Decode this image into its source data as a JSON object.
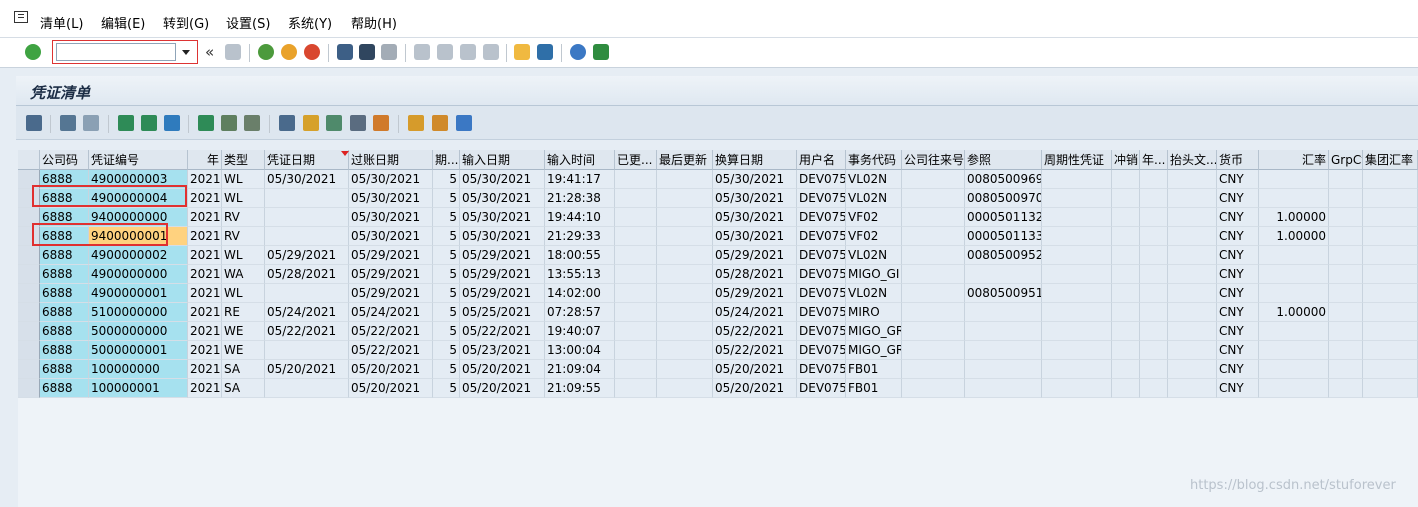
{
  "menu": [
    "清单(L)",
    "编辑(E)",
    "转到(G)",
    "设置(S)",
    "系统(Y)",
    "帮助(H)"
  ],
  "command_field": {
    "value": ""
  },
  "back_chevrons": "«",
  "title": "凭证清单",
  "columns": [
    "",
    "公司码",
    "凭证编号",
    "年",
    "类型",
    "凭证日期",
    "过账日期",
    "期...",
    "输入日期",
    "输入时间",
    "已更...",
    "最后更新",
    "换算日期",
    "用户名",
    "事务代码",
    "公司往来号",
    "参照",
    "周期性凭证",
    "冲销",
    "年...",
    "抬头文...",
    "货币",
    "汇率",
    "GrpCy",
    "集团汇率"
  ],
  "rows": [
    [
      "",
      "6888",
      "4900000003",
      "2021",
      "WL",
      "05/30/2021",
      "05/30/2021",
      "5",
      "05/30/2021",
      "19:41:17",
      "",
      "",
      "05/30/2021",
      "DEV075",
      "VL02N",
      "",
      "0080500969",
      "",
      "",
      "",
      "",
      "CNY",
      "",
      "",
      ""
    ],
    [
      "",
      "6888",
      "4900000004",
      "2021",
      "WL",
      "",
      "05/30/2021",
      "5",
      "05/30/2021",
      "21:28:38",
      "",
      "",
      "05/30/2021",
      "DEV075",
      "VL02N",
      "",
      "0080500970",
      "",
      "",
      "",
      "",
      "CNY",
      "",
      "",
      ""
    ],
    [
      "",
      "6888",
      "9400000000",
      "2021",
      "RV",
      "",
      "05/30/2021",
      "5",
      "05/30/2021",
      "19:44:10",
      "",
      "",
      "05/30/2021",
      "DEV075",
      "VF02",
      "",
      "0000501132",
      "",
      "",
      "",
      "",
      "CNY",
      "1.00000",
      "",
      ""
    ],
    [
      "",
      "6888",
      "9400000001",
      "2021",
      "RV",
      "",
      "05/30/2021",
      "5",
      "05/30/2021",
      "21:29:33",
      "",
      "",
      "05/30/2021",
      "DEV075",
      "VF02",
      "",
      "0000501133",
      "",
      "",
      "",
      "",
      "CNY",
      "1.00000",
      "",
      ""
    ],
    [
      "",
      "6888",
      "4900000002",
      "2021",
      "WL",
      "05/29/2021",
      "05/29/2021",
      "5",
      "05/29/2021",
      "18:00:55",
      "",
      "",
      "05/29/2021",
      "DEV075",
      "VL02N",
      "",
      "0080500952",
      "",
      "",
      "",
      "",
      "CNY",
      "",
      "",
      ""
    ],
    [
      "",
      "6888",
      "4900000000",
      "2021",
      "WA",
      "05/28/2021",
      "05/29/2021",
      "5",
      "05/29/2021",
      "13:55:13",
      "",
      "",
      "05/28/2021",
      "DEV075",
      "MIGO_GI",
      "",
      "",
      "",
      "",
      "",
      "",
      "CNY",
      "",
      "",
      ""
    ],
    [
      "",
      "6888",
      "4900000001",
      "2021",
      "WL",
      "",
      "05/29/2021",
      "5",
      "05/29/2021",
      "14:02:00",
      "",
      "",
      "05/29/2021",
      "DEV075",
      "VL02N",
      "",
      "0080500951",
      "",
      "",
      "",
      "",
      "CNY",
      "",
      "",
      ""
    ],
    [
      "",
      "6888",
      "5100000000",
      "2021",
      "RE",
      "05/24/2021",
      "05/24/2021",
      "5",
      "05/25/2021",
      "07:28:57",
      "",
      "",
      "05/24/2021",
      "DEV075",
      "MIRO",
      "",
      "",
      "",
      "",
      "",
      "",
      "CNY",
      "1.00000",
      "",
      ""
    ],
    [
      "",
      "6888",
      "5000000000",
      "2021",
      "WE",
      "05/22/2021",
      "05/22/2021",
      "5",
      "05/22/2021",
      "19:40:07",
      "",
      "",
      "05/22/2021",
      "DEV075",
      "MIGO_GR",
      "",
      "",
      "",
      "",
      "",
      "",
      "CNY",
      "",
      "",
      ""
    ],
    [
      "",
      "6888",
      "5000000001",
      "2021",
      "WE",
      "",
      "05/22/2021",
      "5",
      "05/23/2021",
      "13:00:04",
      "",
      "",
      "05/22/2021",
      "DEV075",
      "MIGO_GR",
      "",
      "",
      "",
      "",
      "",
      "",
      "CNY",
      "",
      "",
      ""
    ],
    [
      "",
      "6888",
      "100000000",
      "2021",
      "SA",
      "05/20/2021",
      "05/20/2021",
      "5",
      "05/20/2021",
      "21:09:04",
      "",
      "",
      "05/20/2021",
      "DEV075",
      "FB01",
      "",
      "",
      "",
      "",
      "",
      "",
      "CNY",
      "",
      "",
      ""
    ],
    [
      "",
      "6888",
      "100000001",
      "2021",
      "SA",
      "",
      "05/20/2021",
      "5",
      "05/20/2021",
      "21:09:55",
      "",
      "",
      "05/20/2021",
      "DEV075",
      "FB01",
      "",
      "",
      "",
      "",
      "",
      "",
      "CNY",
      "",
      "",
      ""
    ]
  ],
  "watermark": "https://blog.csdn.net/stuforever",
  "colors": {
    "key_column": "#a6e1ef",
    "highlight_cell": "#ffd27f",
    "annotation_box": "#e03030"
  }
}
